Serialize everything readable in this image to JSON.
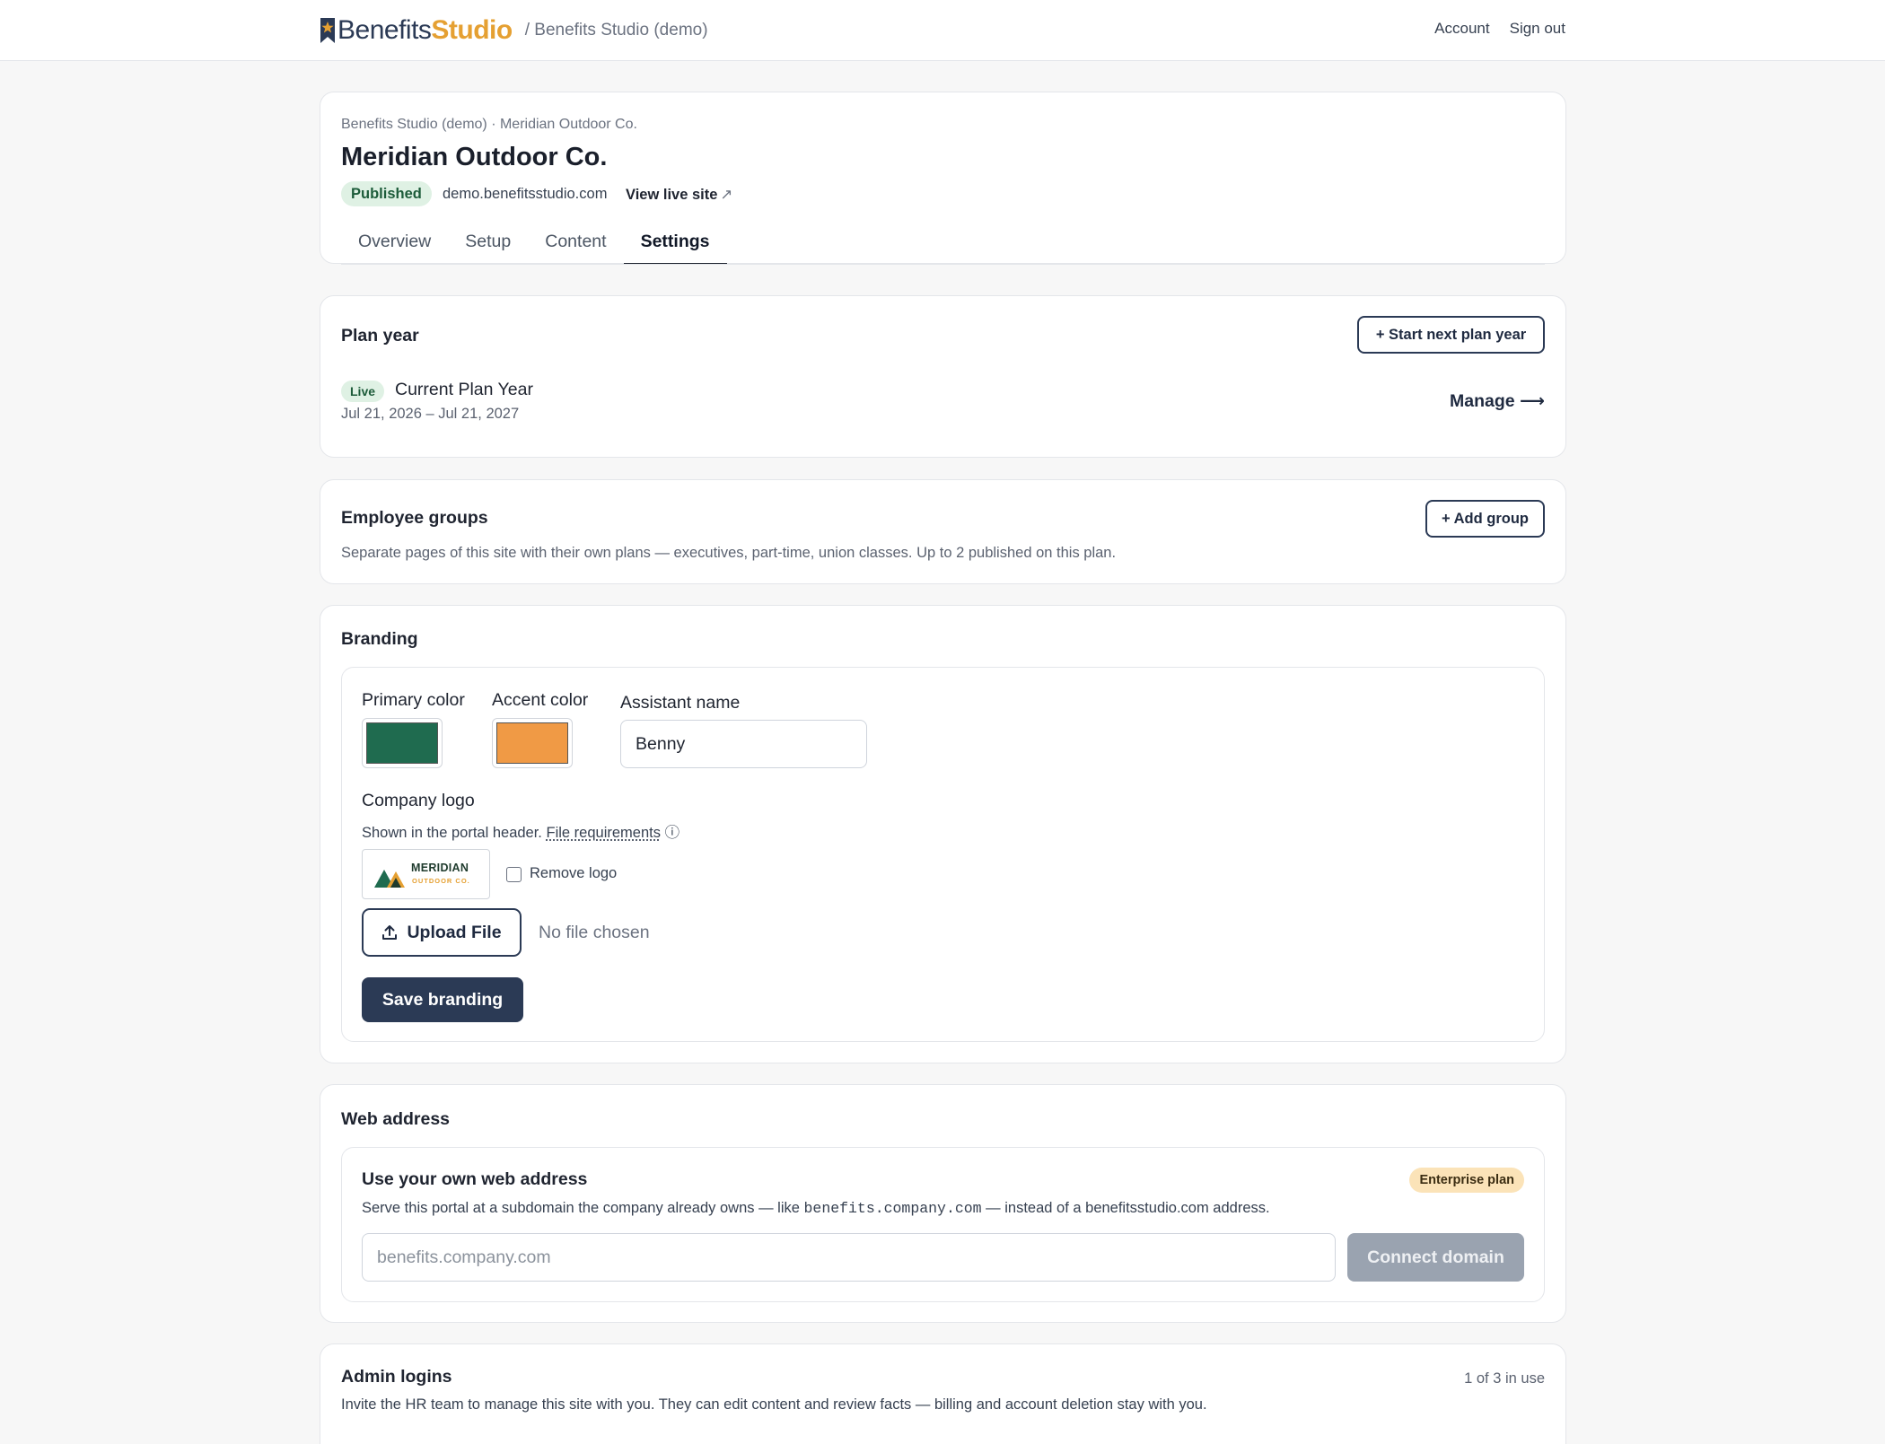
{
  "app": {
    "brand_primary": "Benefits",
    "brand_accent": "Studio",
    "breadcrumb": "/ Benefits Studio (demo)",
    "nav": {
      "account": "Account",
      "sign_out": "Sign out"
    }
  },
  "site": {
    "breadcrumb": "Benefits Studio (demo) · Meridian Outdoor Co.",
    "title": "Meridian Outdoor Co.",
    "status": "Published",
    "domain": "demo.benefitsstudio.com",
    "view_live": "View live site",
    "view_live_icon": "external-link-icon",
    "tabs": [
      {
        "label": "Overview",
        "active": false
      },
      {
        "label": "Setup",
        "active": false
      },
      {
        "label": "Content",
        "active": false
      },
      {
        "label": "Settings",
        "active": true
      }
    ]
  },
  "plan_year": {
    "title": "Plan year",
    "start_button": "+ Start next plan year",
    "badge": "Live",
    "name": "Current Plan Year",
    "dates": "Jul 21, 2026 – Jul 21, 2027",
    "manage": "Manage ⟶"
  },
  "groups": {
    "title": "Employee groups",
    "add_button": "+ Add group",
    "description": "Separate pages of this site with their own plans — executives, part-time, union classes. Up to 2 published on this plan."
  },
  "branding": {
    "title": "Branding",
    "primary_label": "Primary color",
    "primary_color": "#1f6b4f",
    "accent_label": "Accent color",
    "accent_color": "#f09a45",
    "assistant_label": "Assistant name",
    "assistant_value": "Benny",
    "logo_label": "Company logo",
    "logo_help": "Shown in the portal header.",
    "logo_requirements": "File requirements",
    "logo_info_icon": "info-icon",
    "logo_text_1": "MERIDIAN",
    "logo_text_2": "OUTDOOR CO.",
    "remove_logo": "Remove logo",
    "remove_checked": false,
    "upload_button": "Upload File",
    "upload_icon": "upload-icon",
    "no_file": "No file chosen",
    "save_button": "Save branding"
  },
  "web_address": {
    "title": "Web address",
    "subtitle": "Use your own web address",
    "plan_badge": "Enterprise plan",
    "desc_before": "Serve this portal at a subdomain the company already owns — like",
    "desc_code": "benefits.company.com",
    "desc_after": "— instead of a benefitsstudio.com address.",
    "input_placeholder": "benefits.company.com",
    "connect_button": "Connect domain"
  },
  "admin": {
    "title": "Admin logins",
    "count": "1 of 3 in use",
    "description": "Invite the HR team to manage this site with you. They can edit content and review facts — billing and account deletion stay with you."
  },
  "colors": {
    "brand_navy": "#2b3a55",
    "brand_gold": "#e5a032",
    "published_bg": "#dff1e4",
    "enterprise_bg": "#fbe3b8"
  }
}
